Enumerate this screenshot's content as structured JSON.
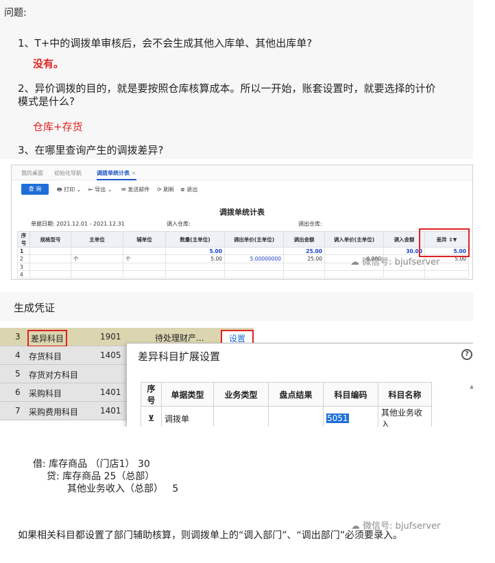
{
  "qa": {
    "question_heading": "问题:",
    "q1": "1、T+中的调拨单审核后，会不会生成其他入库单、其他出库单?",
    "a1": "没有。",
    "q2_line1": "2、异价调拨的目的，就是要按照仓库核算成本。所以一开始，账套设置时，就要选择的计价",
    "q2_line2": "模式是什么?",
    "a2": "仓库+存货",
    "q3": "3、在哪里查询产生的调拨差异?"
  },
  "report_screenshot": {
    "tabs": [
      "我的桌面",
      "初始化导航",
      "调拨单统计表"
    ],
    "tab_close": "×",
    "toolbar": {
      "query": "查 询",
      "print": "打印",
      "export": "导出",
      "send_mail": "发送邮件",
      "refresh": "刷新",
      "exit": "退出"
    },
    "title": "调拨单统计表",
    "date_label": "单据日期:",
    "date_value": "2021.12.01 - 2021.12.31",
    "in_warehouse_label": "调入仓库:",
    "out_warehouse_label": "调出仓库:",
    "columns": [
      "序号",
      "规格型号",
      "主单位",
      "辅单位",
      "数量(主单位)",
      "调出单价(主单位)",
      "调出金额",
      "调入单价(主单位)",
      "调入金额",
      "差异"
    ],
    "rows": [
      {
        "no": "1",
        "spec": "",
        "unit": "",
        "aux_unit": "",
        "qty": "5.00",
        "out_price": "",
        "out_amount": "25.00",
        "in_price": "",
        "in_amount": "30.00",
        "diff": "5.00"
      },
      {
        "no": "2",
        "spec": "",
        "unit": "个",
        "aux_unit": "个",
        "qty": "5.00",
        "out_price": "5.00000000",
        "out_amount": "25.00",
        "in_price": "6.000",
        "in_amount": "",
        "diff": "5.00"
      },
      {
        "no": "3",
        "spec": "",
        "unit": "",
        "aux_unit": "",
        "qty": "",
        "out_price": "",
        "out_amount": "",
        "in_price": "",
        "in_amount": "",
        "diff": ""
      },
      {
        "no": "4",
        "spec": "",
        "unit": "",
        "aux_unit": "",
        "qty": "",
        "out_price": "",
        "out_amount": "",
        "in_price": "",
        "in_amount": "",
        "diff": ""
      }
    ],
    "watermark": "微信号: bjufserver"
  },
  "voucher_heading": "生成凭证",
  "subject_screenshot": {
    "rows": [
      {
        "no": "3",
        "name": "差异科目",
        "code": "1901",
        "extra": "待处理财产...",
        "action": "设置"
      },
      {
        "no": "4",
        "name": "存货科目",
        "code": "1405",
        "extra": "",
        "action": ""
      },
      {
        "no": "5",
        "name": "存货对方科目",
        "code": "",
        "extra": "",
        "action": ""
      },
      {
        "no": "6",
        "name": "采购科目",
        "code": "1401",
        "extra": "",
        "action": ""
      },
      {
        "no": "7",
        "name": "采购费用科目",
        "code": "1401",
        "extra": "",
        "action": ""
      }
    ],
    "dialog_title": "差异科目扩展设置",
    "help": "?",
    "columns": [
      "序号",
      "单据类型",
      "业务类型",
      "盘点结果",
      "科目编码",
      "科目名称"
    ],
    "dialog_row": {
      "doc_type": "调拨单",
      "biz_type": "",
      "count_result": "",
      "code": "5051",
      "name": "其他业务收入"
    }
  },
  "journal": {
    "line1": "借: 库存商品 （门店1） 30",
    "line2": "贷: 库存商品 25（总部）",
    "line3": "其他业务收入（总部）   5"
  },
  "watermark2": "微信号: bjufserver",
  "final_note": "如果相关科目都设置了部门辅助核算，则调拨单上的“调入部门”、“调出部门”必须要录入。",
  "colors": {
    "accent_red": "#e02020",
    "link_blue": "#1f6fd8"
  }
}
